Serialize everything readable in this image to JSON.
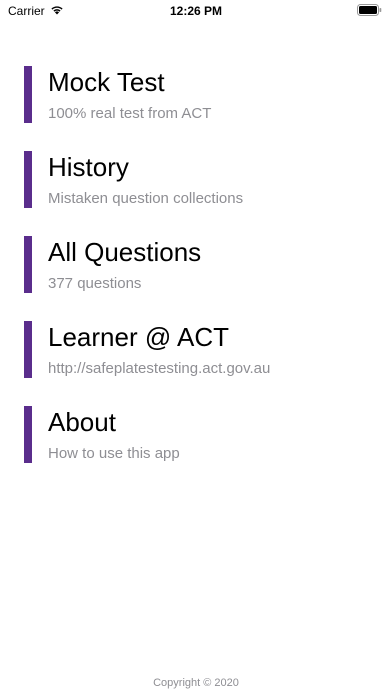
{
  "status_bar": {
    "carrier": "Carrier",
    "time": "12:26 PM",
    "wifi_icon": "wifi-icon",
    "battery_icon": "battery-icon"
  },
  "colors": {
    "accent": "#5a2d8c",
    "subtitle": "#8e8e93"
  },
  "menu": {
    "items": [
      {
        "title": "Mock Test",
        "subtitle": "100% real test from ACT"
      },
      {
        "title": "History",
        "subtitle": "Mistaken question collections"
      },
      {
        "title": "All Questions",
        "subtitle": "377 questions"
      },
      {
        "title": "Learner @ ACT",
        "subtitle": "http://safeplatestesting.act.gov.au"
      },
      {
        "title": "About",
        "subtitle": "How to use this app"
      }
    ]
  },
  "footer": {
    "copyright": "Copyright © 2020"
  }
}
